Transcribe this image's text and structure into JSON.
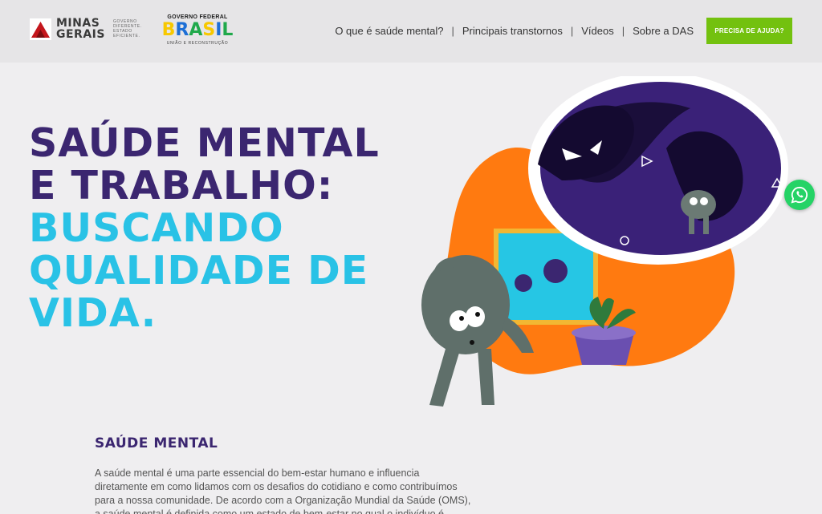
{
  "header": {
    "gov_logo": {
      "name_line1": "MINAS",
      "name_line2": "GERAIS",
      "tagline": [
        "GOVERNO",
        "DIFERENTE.",
        "ESTADO",
        "EFICIENTE."
      ]
    },
    "federal_logo": {
      "top": "GOVERNO FEDERAL",
      "word": [
        "B",
        "R",
        "A",
        "S",
        "I",
        "L"
      ],
      "word_colors": [
        "#f7c800",
        "#1d6fd6",
        "#20a94b",
        "#f7c800",
        "#1d6fd6",
        "#20a94b"
      ],
      "bottom": "UNIÃO E RECONSTRUÇÃO"
    },
    "nav": [
      {
        "label": "O que é saúde mental?"
      },
      {
        "label": "Principais transtornos"
      },
      {
        "label": "Vídeos"
      },
      {
        "label": "Sobre a DAS"
      }
    ],
    "help_button": "PRECISA DE AJUDA?"
  },
  "hero": {
    "line1": "SAÚDE MENTAL",
    "line2": "E TRABALHO:",
    "line3": "BUSCANDO",
    "line4": "QUALIDADE DE",
    "line5": "VIDA."
  },
  "section": {
    "title": "SAÚDE MENTAL",
    "text": "A saúde mental é uma parte essencial do bem-estar humano e influencia diretamente em como lidamos com os desafios do cotidiano e como contribuímos para a nossa comunidade. De acordo com a Organização Mundial da Saúde (OMS), a saúde mental é definida como um estado de bem-estar no qual o indivíduo é"
  },
  "colors": {
    "brand_purple": "#3b2670",
    "brand_cyan": "#29c2e6",
    "accent_orange": "#ff7a10",
    "help_green": "#73c10f"
  }
}
